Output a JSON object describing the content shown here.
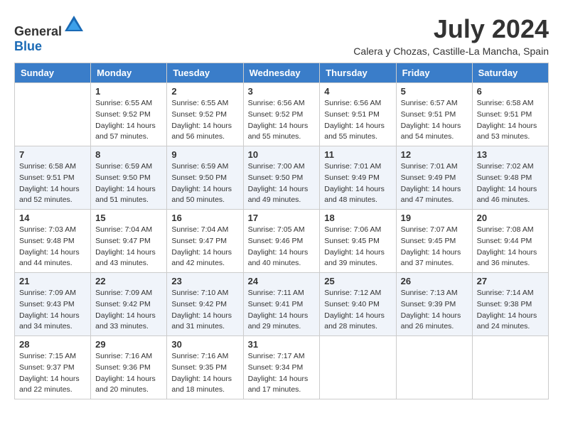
{
  "logo": {
    "general": "General",
    "blue": "Blue"
  },
  "title": {
    "month_year": "July 2024",
    "location": "Calera y Chozas, Castille-La Mancha, Spain"
  },
  "weekdays": [
    "Sunday",
    "Monday",
    "Tuesday",
    "Wednesday",
    "Thursday",
    "Friday",
    "Saturday"
  ],
  "weeks": [
    [
      {
        "day": "",
        "sunrise": "",
        "sunset": "",
        "daylight": ""
      },
      {
        "day": "1",
        "sunrise": "Sunrise: 6:55 AM",
        "sunset": "Sunset: 9:52 PM",
        "daylight": "Daylight: 14 hours and 57 minutes."
      },
      {
        "day": "2",
        "sunrise": "Sunrise: 6:55 AM",
        "sunset": "Sunset: 9:52 PM",
        "daylight": "Daylight: 14 hours and 56 minutes."
      },
      {
        "day": "3",
        "sunrise": "Sunrise: 6:56 AM",
        "sunset": "Sunset: 9:52 PM",
        "daylight": "Daylight: 14 hours and 55 minutes."
      },
      {
        "day": "4",
        "sunrise": "Sunrise: 6:56 AM",
        "sunset": "Sunset: 9:51 PM",
        "daylight": "Daylight: 14 hours and 55 minutes."
      },
      {
        "day": "5",
        "sunrise": "Sunrise: 6:57 AM",
        "sunset": "Sunset: 9:51 PM",
        "daylight": "Daylight: 14 hours and 54 minutes."
      },
      {
        "day": "6",
        "sunrise": "Sunrise: 6:58 AM",
        "sunset": "Sunset: 9:51 PM",
        "daylight": "Daylight: 14 hours and 53 minutes."
      }
    ],
    [
      {
        "day": "7",
        "sunrise": "Sunrise: 6:58 AM",
        "sunset": "Sunset: 9:51 PM",
        "daylight": "Daylight: 14 hours and 52 minutes."
      },
      {
        "day": "8",
        "sunrise": "Sunrise: 6:59 AM",
        "sunset": "Sunset: 9:50 PM",
        "daylight": "Daylight: 14 hours and 51 minutes."
      },
      {
        "day": "9",
        "sunrise": "Sunrise: 6:59 AM",
        "sunset": "Sunset: 9:50 PM",
        "daylight": "Daylight: 14 hours and 50 minutes."
      },
      {
        "day": "10",
        "sunrise": "Sunrise: 7:00 AM",
        "sunset": "Sunset: 9:50 PM",
        "daylight": "Daylight: 14 hours and 49 minutes."
      },
      {
        "day": "11",
        "sunrise": "Sunrise: 7:01 AM",
        "sunset": "Sunset: 9:49 PM",
        "daylight": "Daylight: 14 hours and 48 minutes."
      },
      {
        "day": "12",
        "sunrise": "Sunrise: 7:01 AM",
        "sunset": "Sunset: 9:49 PM",
        "daylight": "Daylight: 14 hours and 47 minutes."
      },
      {
        "day": "13",
        "sunrise": "Sunrise: 7:02 AM",
        "sunset": "Sunset: 9:48 PM",
        "daylight": "Daylight: 14 hours and 46 minutes."
      }
    ],
    [
      {
        "day": "14",
        "sunrise": "Sunrise: 7:03 AM",
        "sunset": "Sunset: 9:48 PM",
        "daylight": "Daylight: 14 hours and 44 minutes."
      },
      {
        "day": "15",
        "sunrise": "Sunrise: 7:04 AM",
        "sunset": "Sunset: 9:47 PM",
        "daylight": "Daylight: 14 hours and 43 minutes."
      },
      {
        "day": "16",
        "sunrise": "Sunrise: 7:04 AM",
        "sunset": "Sunset: 9:47 PM",
        "daylight": "Daylight: 14 hours and 42 minutes."
      },
      {
        "day": "17",
        "sunrise": "Sunrise: 7:05 AM",
        "sunset": "Sunset: 9:46 PM",
        "daylight": "Daylight: 14 hours and 40 minutes."
      },
      {
        "day": "18",
        "sunrise": "Sunrise: 7:06 AM",
        "sunset": "Sunset: 9:45 PM",
        "daylight": "Daylight: 14 hours and 39 minutes."
      },
      {
        "day": "19",
        "sunrise": "Sunrise: 7:07 AM",
        "sunset": "Sunset: 9:45 PM",
        "daylight": "Daylight: 14 hours and 37 minutes."
      },
      {
        "day": "20",
        "sunrise": "Sunrise: 7:08 AM",
        "sunset": "Sunset: 9:44 PM",
        "daylight": "Daylight: 14 hours and 36 minutes."
      }
    ],
    [
      {
        "day": "21",
        "sunrise": "Sunrise: 7:09 AM",
        "sunset": "Sunset: 9:43 PM",
        "daylight": "Daylight: 14 hours and 34 minutes."
      },
      {
        "day": "22",
        "sunrise": "Sunrise: 7:09 AM",
        "sunset": "Sunset: 9:42 PM",
        "daylight": "Daylight: 14 hours and 33 minutes."
      },
      {
        "day": "23",
        "sunrise": "Sunrise: 7:10 AM",
        "sunset": "Sunset: 9:42 PM",
        "daylight": "Daylight: 14 hours and 31 minutes."
      },
      {
        "day": "24",
        "sunrise": "Sunrise: 7:11 AM",
        "sunset": "Sunset: 9:41 PM",
        "daylight": "Daylight: 14 hours and 29 minutes."
      },
      {
        "day": "25",
        "sunrise": "Sunrise: 7:12 AM",
        "sunset": "Sunset: 9:40 PM",
        "daylight": "Daylight: 14 hours and 28 minutes."
      },
      {
        "day": "26",
        "sunrise": "Sunrise: 7:13 AM",
        "sunset": "Sunset: 9:39 PM",
        "daylight": "Daylight: 14 hours and 26 minutes."
      },
      {
        "day": "27",
        "sunrise": "Sunrise: 7:14 AM",
        "sunset": "Sunset: 9:38 PM",
        "daylight": "Daylight: 14 hours and 24 minutes."
      }
    ],
    [
      {
        "day": "28",
        "sunrise": "Sunrise: 7:15 AM",
        "sunset": "Sunset: 9:37 PM",
        "daylight": "Daylight: 14 hours and 22 minutes."
      },
      {
        "day": "29",
        "sunrise": "Sunrise: 7:16 AM",
        "sunset": "Sunset: 9:36 PM",
        "daylight": "Daylight: 14 hours and 20 minutes."
      },
      {
        "day": "30",
        "sunrise": "Sunrise: 7:16 AM",
        "sunset": "Sunset: 9:35 PM",
        "daylight": "Daylight: 14 hours and 18 minutes."
      },
      {
        "day": "31",
        "sunrise": "Sunrise: 7:17 AM",
        "sunset": "Sunset: 9:34 PM",
        "daylight": "Daylight: 14 hours and 17 minutes."
      },
      {
        "day": "",
        "sunrise": "",
        "sunset": "",
        "daylight": ""
      },
      {
        "day": "",
        "sunrise": "",
        "sunset": "",
        "daylight": ""
      },
      {
        "day": "",
        "sunrise": "",
        "sunset": "",
        "daylight": ""
      }
    ]
  ]
}
